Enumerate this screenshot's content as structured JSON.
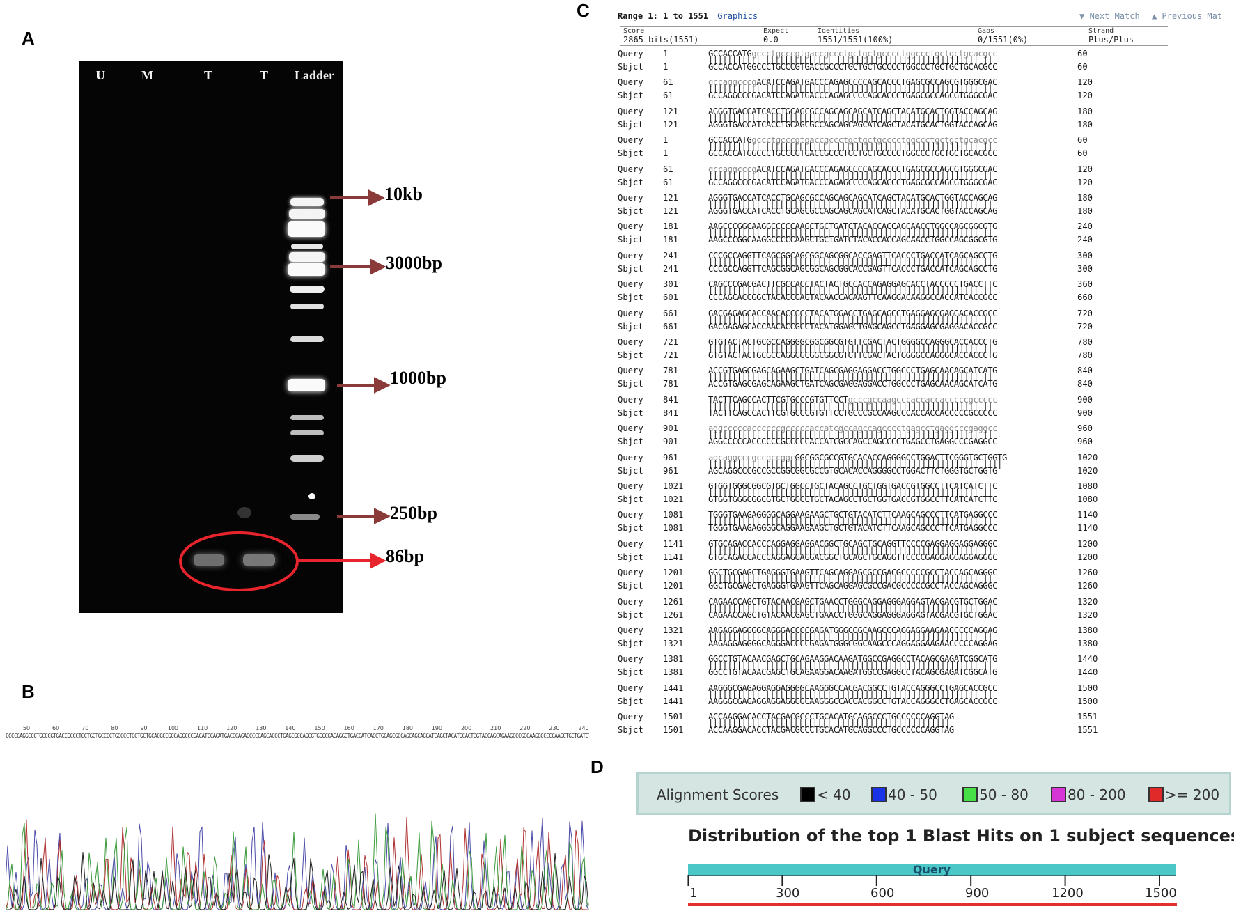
{
  "panels": {
    "a": "A",
    "b": "B",
    "c": "C",
    "d": "D"
  },
  "gel": {
    "lanes": [
      "U",
      "M",
      "T",
      "T",
      "Ladder"
    ],
    "markers": [
      "10kb",
      "3000bp",
      "1000bp",
      "250bp",
      "86bp"
    ],
    "colors": {
      "marker_arrow": "#8b3a3a",
      "highlight": "#e8242c"
    }
  },
  "chromatogram": {
    "ruler": [
      "50",
      "60",
      "70",
      "80",
      "90",
      "100",
      "110",
      "120",
      "130",
      "140",
      "150",
      "160",
      "170",
      "180",
      "190",
      "200",
      "210",
      "220",
      "230",
      "240"
    ],
    "sequence": "CCCCCAGGCCCTGCCCGTGACCGCCCTGCTGCTGCCCCTGGCCCTGCTGCTGCACGCCGCCAGGCCCGACATCCAGATGACCCAGAGCCCCAGCACCCTGAGCGCCAGCGTGGGCGACAGGGTGACCATCACCTGCAGCGCCAGCAGCAGCATCAGCTACATGCACTGGTACCAGCAGAAGCCCGGCAAGGCCCCCAAGCTGCTGATCTACACCACCAGCAACCTGGCCAGCGGCGTGCCCGCCAGG",
    "trace_colors": [
      "#4a4aa8",
      "#b03030",
      "#3a9a3a",
      "#222222"
    ]
  },
  "blast": {
    "range_label": "Range 1: 1 to 1551",
    "graphics_link": "Graphics",
    "next_match": "▼ Next Match",
    "previous_match": "▲ Previous Mat",
    "score": {
      "headers": [
        "Score",
        "Expect",
        "Identities",
        "Gaps",
        "Strand"
      ],
      "values": [
        "2865 bits(1551)",
        "0.0",
        "1551/1551(100%)",
        "0/1551(0%)",
        "Plus/Plus"
      ]
    },
    "rows": [
      {
        "label": "Query",
        "start": "1",
        "seq": "GCCACCATGgccctgcccgtgaccgccctgctgctgcccctggccctgctgctgcacgcc",
        "end": "60"
      },
      {
        "label": "Sbjct",
        "start": "1",
        "seq": "GCCACCATGGCCCTGCCCGTGACCGCCCTGCTGCTGCCCCTGGCCCTGCTGCTGCACGCC",
        "end": "60"
      },
      {
        "label": "Query",
        "start": "61",
        "seq": "gccaggcccgACATCCAGATGACCCAGAGCCCCAGCACCCTGAGCGCCAGCGTGGGCGAC",
        "end": "120"
      },
      {
        "label": "Sbjct",
        "start": "61",
        "seq": "GCCAGGCCCGACATCCAGATGACCCAGAGCCCCAGCACCCTGAGCGCCAGCGTGGGCGAC",
        "end": "120"
      },
      {
        "label": "Query",
        "start": "121",
        "seq": "AGGGTGACCATCACCTGCAGCGCCAGCAGCAGCATCAGCTACATGCACTGGTACCAGCAG",
        "end": "180"
      },
      {
        "label": "Sbjct",
        "start": "121",
        "seq": "AGGGTGACCATCACCTGCAGCGCCAGCAGCAGCATCAGCTACATGCACTGGTACCAGCAG",
        "end": "180"
      },
      {
        "label": "Query",
        "start": "1",
        "seq": "GCCACCATGgccctgcccgtgaccgccctgctgctgcccctggccctgctgctgcacgcc",
        "end": "60"
      },
      {
        "label": "Sbjct",
        "start": "1",
        "seq": "GCCACCATGGCCCTGCCCGTGACCGCCCTGCTGCTGCCCCTGGCCCTGCTGCTGCACGCC",
        "end": "60"
      },
      {
        "label": "Query",
        "start": "61",
        "seq": "gccaggcccgACATCCAGATGACCCAGAGCCCCAGCACCCTGAGCGCCAGCGTGGGCGAC",
        "end": "120"
      },
      {
        "label": "Sbjct",
        "start": "61",
        "seq": "GCCAGGCCCGACATCCAGATGACCCAGAGCCCCAGCACCCTGAGCGCCAGCGTGGGCGAC",
        "end": "120"
      },
      {
        "label": "Query",
        "start": "121",
        "seq": "AGGGTGACCATCACCTGCAGCGCCAGCAGCAGCATCAGCTACATGCACTGGTACCAGCAG",
        "end": "180"
      },
      {
        "label": "Sbjct",
        "start": "121",
        "seq": "AGGGTGACCATCACCTGCAGCGCCAGCAGCAGCATCAGCTACATGCACTGGTACCAGCAG",
        "end": "180"
      },
      {
        "label": "Query",
        "start": "181",
        "seq": "AAGCCCGGCAAGGCCCCCAAGCTGCTGATCTACACCACCAGCAACCTGGCCAGCGGCGTG",
        "end": "240"
      },
      {
        "label": "Sbjct",
        "start": "181",
        "seq": "AAGCCCGGCAAGGCCCCCAAGCTGCTGATCTACACCACCAGCAACCTGGCCAGCGGCGTG",
        "end": "240"
      },
      {
        "label": "Query",
        "start": "241",
        "seq": "CCCGCCAGGTTCAGCGGCAGCGGCAGCGGCACCGAGTTCACCCTGACCATCAGCAGCCTG",
        "end": "300"
      },
      {
        "label": "Sbjct",
        "start": "241",
        "seq": "CCCGCCAGGTTCAGCGGCAGCGGCAGCGGCACCGAGTTCACCCTGACCATCAGCAGCCTG",
        "end": "300"
      },
      {
        "label": "Query",
        "start": "301",
        "seq": "CAGCCCGACGACTTCGCCACCTACTACTGCCACCAGAGGAGCACCTACCCCCTGACCTTC",
        "end": "360"
      },
      {
        "label": "Sbjct",
        "start": "601",
        "seq": "CCCAGCACCGGCTACACCGAGTACAACCAGAAGTTCAAGGACAAGGCCACCATCACCGCC",
        "end": "660"
      },
      {
        "label": "Query",
        "start": "661",
        "seq": "GACGAGAGCACCAACACCGCCTACATGGAGCTGAGCAGCCTGAGGAGCGAGGACACCGCC",
        "end": "720"
      },
      {
        "label": "Sbjct",
        "start": "661",
        "seq": "GACGAGAGCACCAACACCGCCTACATGGAGCTGAGCAGCCTGAGGAGCGAGGACACCGCC",
        "end": "720"
      },
      {
        "label": "Query",
        "start": "721",
        "seq": "GTGTACTACTGCGCCAGGGGCGGCGGCGTGTTCGACTACTGGGGCCAGGGCACCACCCTG",
        "end": "780"
      },
      {
        "label": "Sbjct",
        "start": "721",
        "seq": "GTGTACTACTGCGCCAGGGGCGGCGGCGTGTTCGACTACTGGGGCCAGGGCACCACCCTG",
        "end": "780"
      },
      {
        "label": "Query",
        "start": "781",
        "seq": "ACCGTGAGCGAGCAGAAGCTGATCAGCGAGGAGGACCTGGCCCTGAGCAACAGCATCATG",
        "end": "840"
      },
      {
        "label": "Sbjct",
        "start": "781",
        "seq": "ACCGTGAGCGAGCAGAAGCTGATCAGCGAGGAGGACCTGGCCCTGAGCAACAGCATCATG",
        "end": "840"
      },
      {
        "label": "Query",
        "start": "841",
        "seq": "TACTTCAGCCACTTCGTGCCCGTGTTCCTgcccgccaagcccaccaccacccccgccccc",
        "end": "900"
      },
      {
        "label": "Sbjct",
        "start": "841",
        "seq": "TACTTCAGCCACTTCGTGCCCGTGTTCCTGCCCGCCAAGCCCACCACCACCCCCGCCCCC",
        "end": "900"
      },
      {
        "label": "Query",
        "start": "901",
        "seq": "aggcccccaccccccgcccccaccatcgccagccagcccctgagcctgaggcccgaggcc",
        "end": "960"
      },
      {
        "label": "Sbjct",
        "start": "901",
        "seq": "AGGCCCCCACCCCCCGCCCCCACCATCGCCAGCCAGCCCCTGAGCCTGAGGCCCGAGGCC",
        "end": "960"
      },
      {
        "label": "Query",
        "start": "961",
        "seq": "agcaggcccgccgccggcGGCGGCGCCGTGCACACCAGGGGCCTGGACTTCGGGTGCTGGTG",
        "end": "1020"
      },
      {
        "label": "Sbjct",
        "start": "961",
        "seq": "AGCAGGCCCGCCGCCGGCGGCGCCGTGCACACCAGGGGCCTGGACTTCTGGGTGCTGGTG",
        "end": "1020"
      },
      {
        "label": "Query",
        "start": "1021",
        "seq": "GTGGTGGGCGGCGTGCTGGCCTGCTACAGCCTGCTGGTGACCGTGGCCTTCATCATCTTC",
        "end": "1080"
      },
      {
        "label": "Sbjct",
        "start": "1021",
        "seq": "GTGGTGGGCGGCGTGCTGGCCTGCTACAGCCTGCTGGTGACCGTGGCCTTCATCATCTTC",
        "end": "1080"
      },
      {
        "label": "Query",
        "start": "1081",
        "seq": "TGGGTGAAGAGGGGCAGGAAGAAGCTGCTGTACATCTTCAAGCAGCCCTTCATGAGGCCC",
        "end": "1140"
      },
      {
        "label": "Sbjct",
        "start": "1081",
        "seq": "TGGGTGAAGAGGGGCAGGAAGAAGCTGCTGTACATCTTCAAGCAGCCCTTCATGAGGCCC",
        "end": "1140"
      },
      {
        "label": "Query",
        "start": "1141",
        "seq": "GTGCAGACCACCCAGGAGGAGGACGGCTGCAGCTGCAGGTTCCCCGAGGAGGAGGAGGGC",
        "end": "1200"
      },
      {
        "label": "Sbjct",
        "start": "1141",
        "seq": "GTGCAGACCACCCAGGAGGAGGACGGCTGCAGCTGCAGGTTCCCCGAGGAGGAGGAGGGC",
        "end": "1200"
      },
      {
        "label": "Query",
        "start": "1201",
        "seq": "GGCTGCGAGCTGAGGGTGAAGTTCAGCAGGAGCGCCGACGCCCCCGCCTACCAGCAGGGC",
        "end": "1260"
      },
      {
        "label": "Sbjct",
        "start": "1201",
        "seq": "GGCTGCGAGCTGAGGGTGAAGTTCAGCAGGAGCGCCGACGCCCCCGCCTACCAGCAGGGC",
        "end": "1260"
      },
      {
        "label": "Query",
        "start": "1261",
        "seq": "CAGAACCAGCTGTACAACGAGCTGAACCTGGGCAGGAGGGAGGAGTACGACGTGCTGGAC",
        "end": "1320"
      },
      {
        "label": "Sbjct",
        "start": "1261",
        "seq": "CAGAACCAGCTGTACAACGAGCTGAACCTGGGCAGGAGGGAGGAGTACGACGTGCTGGAC",
        "end": "1320"
      },
      {
        "label": "Query",
        "start": "1321",
        "seq": "AAGAGGAGGGGCAGGGACCCCGAGATGGGCGGCAAGCCCAGGAGGAAGAACCCCCAGGAG",
        "end": "1380"
      },
      {
        "label": "Sbjct",
        "start": "1321",
        "seq": "AAGAGGAGGGGCAGGGACCCCGAGATGGGCGGCAAGCCCAGGAGGAAGAACCCCCAGGAG",
        "end": "1380"
      },
      {
        "label": "Query",
        "start": "1381",
        "seq": "GGCCTGTACAACGAGCTGCAGAAGGACAAGATGGCCGAGGCCTACAGCGAGATCGGCATG",
        "end": "1440"
      },
      {
        "label": "Sbjct",
        "start": "1381",
        "seq": "GGCCTGTACAACGAGCTGCAGAAGGACAAGATGGCCGAGGCCTACAGCGAGATCGGCATG",
        "end": "1440"
      },
      {
        "label": "Query",
        "start": "1441",
        "seq": "AAGGGCGAGAGGAGGAGGGGCAAGGGCCACGACGGCCTGTACCAGGGCCTGAGCACCGCC",
        "end": "1500"
      },
      {
        "label": "Sbjct",
        "start": "1441",
        "seq": "AAGGGCGAGAGGAGGAGGGGCAAGGGCCACGACGGCCTGTACCAGGGCCTGAGCACCGCC",
        "end": "1500"
      },
      {
        "label": "Query",
        "start": "1501",
        "seq": "ACCAAGGACACCTACGACGCCCTGCACATGCAGGCCCTGCCCCCCAGGTAG",
        "end": "1551"
      },
      {
        "label": "Sbjct",
        "start": "1501",
        "seq": "ACCAAGGACACCTACGACGCCCTGCACATGCAGGCCCTGCCCCCCAGGTAG",
        "end": "1551"
      }
    ]
  },
  "alignment_scores": {
    "label": "Alignment Scores",
    "legend": [
      {
        "label": "< 40",
        "color": "#000000"
      },
      {
        "label": "40 - 50",
        "color": "#1a33e6"
      },
      {
        "label": "50 - 80",
        "color": "#47e047"
      },
      {
        "label": "80 - 200",
        "color": "#d636d6"
      },
      {
        "label": ">= 200",
        "color": "#e02a2a"
      }
    ],
    "title": "Distribution of the top 1 Blast Hits on 1 subject sequences",
    "query_label": "Query",
    "axis_ticks": [
      "1",
      "300",
      "600",
      "900",
      "1200",
      "1500"
    ],
    "hit_color": "#e02a2a"
  }
}
